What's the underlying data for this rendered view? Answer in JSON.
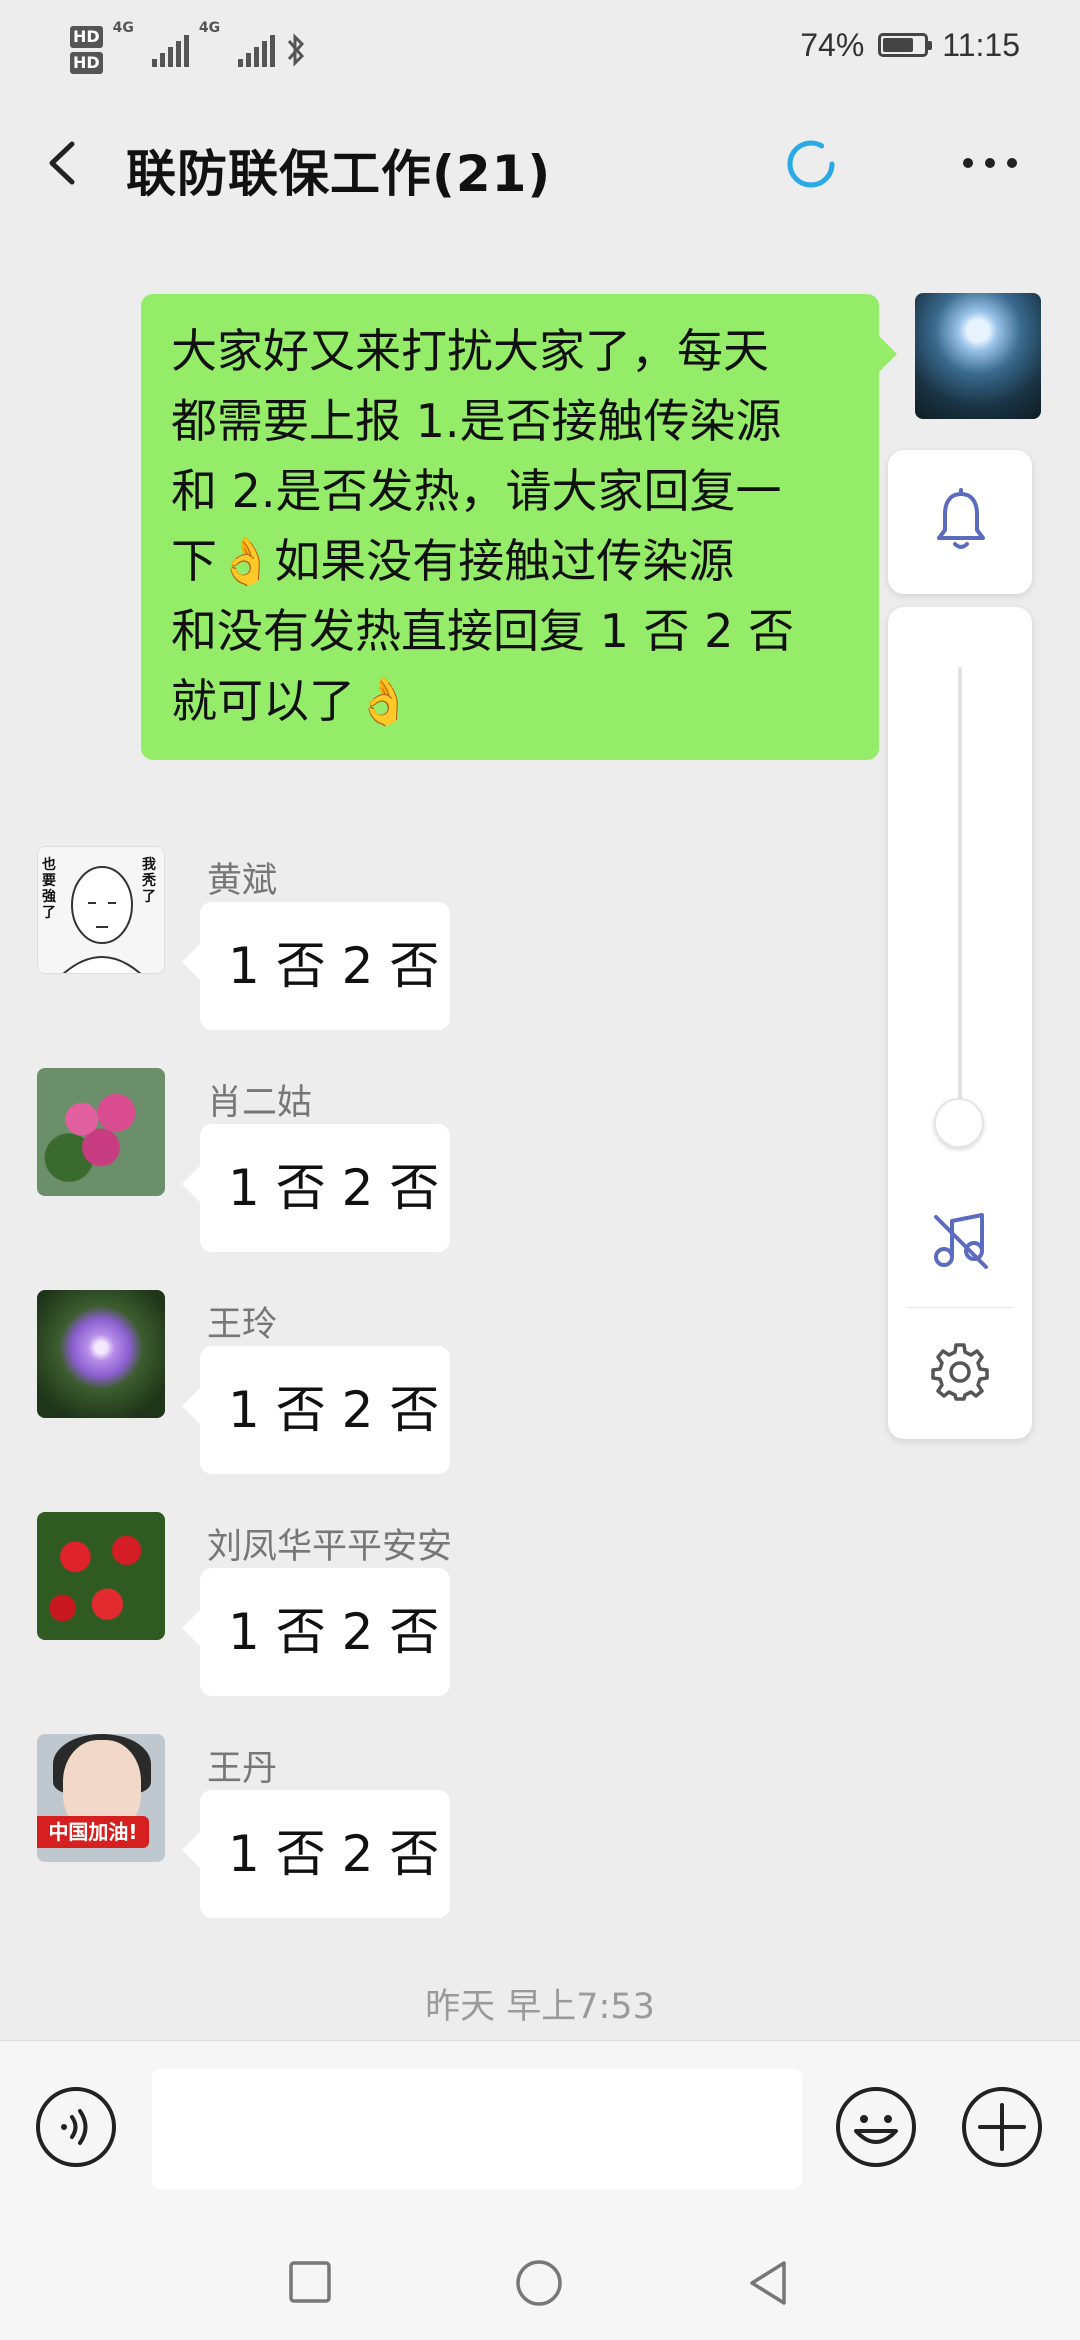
{
  "status_bar": {
    "hd1": "HD",
    "hd2": "HD",
    "net1": "4G",
    "net2": "4G",
    "battery_percent": "74%",
    "battery_level": 0.74,
    "time": "11:15"
  },
  "header": {
    "title": "联防联保工作(21)"
  },
  "my_message": {
    "line1": "大家好又来打扰大家了，每天",
    "line2": "都需要上报 1.是否接触传染源",
    "line3": "和 2.是否发热，请大家回复一",
    "line4": "下👌如果没有接触过传染源",
    "line5": "和没有发热直接回复 1 否 2 否",
    "line6": "就可以了👌"
  },
  "messages": [
    {
      "sender": "黄斌",
      "text": "1 否 2 否",
      "avatar_text_left": "也要強了",
      "avatar_text_right": "我秃了"
    },
    {
      "sender": "肖二姑",
      "text": "1 否 2 否"
    },
    {
      "sender": "王玲",
      "text": "1 否 2 否"
    },
    {
      "sender": "刘凤华平平安安",
      "text": "1 否 2 否"
    },
    {
      "sender": "王丹",
      "text": "1 否 2 否",
      "avatar_banner": "中国加油!"
    }
  ],
  "float_panel": {
    "volume_level": 0.05
  },
  "timestamp": "昨天 早上7:53",
  "input": {
    "value": "",
    "placeholder": ""
  },
  "colors": {
    "my_bubble": "#95ec69",
    "accent": "#5b6bc0",
    "loading": "#29a9e6"
  }
}
